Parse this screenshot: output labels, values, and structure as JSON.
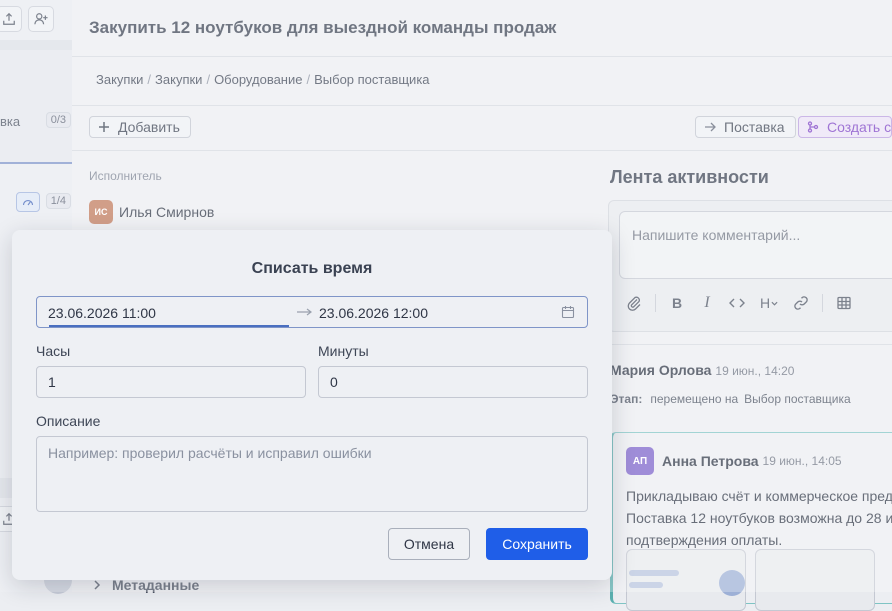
{
  "left_panel": {
    "truncated_label": "вка",
    "badge_1": "0/3",
    "badge_2": "1/4"
  },
  "task": {
    "title": "Закупить 12 ноутбуков для выездной команды продаж"
  },
  "breadcrumb": [
    "Закупки",
    "Закупки",
    "Оборудование",
    "Выбор поставщика"
  ],
  "toolbar": {
    "add_label": "Добавить",
    "delivery_label": "Поставка",
    "create_label": "Создать с"
  },
  "details": {
    "assignee_label": "Исполнитель",
    "assignee_initials": "ИС",
    "assignee_name": "Илья Смирнов",
    "metadata_label": "Метаданные"
  },
  "activity": {
    "title": "Лента активности",
    "comment_placeholder": "Напишите комментарий...",
    "event": {
      "author": "Мария Орлова",
      "time": "19 июн., 14:20",
      "key": "Этап:",
      "action": "перемещено на",
      "value": "Выбор поставщика"
    },
    "reply": {
      "initials": "АП",
      "author": "Анна Петрова",
      "time": "19 июн., 14:05",
      "line1": "Прикладываю счёт и коммерческое пред",
      "line2": "Поставка 12 ноутбуков возможна до 28 и",
      "line3": "подтверждения оплаты."
    }
  },
  "modal": {
    "title": "Списать время",
    "date_start": "23.06.2026 11:00",
    "date_end": "23.06.2026 12:00",
    "hours_label": "Часы",
    "hours_value": "1",
    "minutes_label": "Минуты",
    "minutes_value": "0",
    "description_label": "Описание",
    "description_placeholder": "Например: проверил расчёты и исправил ошибки",
    "cancel_label": "Отмена",
    "save_label": "Сохранить"
  },
  "colors": {
    "accent": "#1f5ee8",
    "avatar_is": "#c0795a",
    "avatar_ap": "#7b61c9",
    "create_button": "#7a3fc4"
  }
}
